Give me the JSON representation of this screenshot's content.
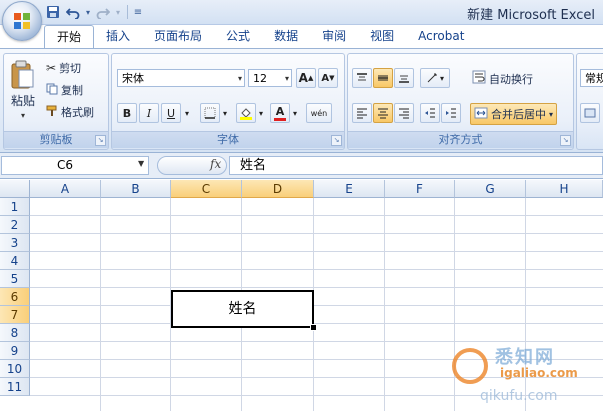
{
  "window": {
    "title": "新建 Microsoft Excel"
  },
  "quick_access": {
    "icons": [
      "save-icon",
      "undo-icon",
      "redo-icon",
      "customize-icon"
    ]
  },
  "tabs": [
    {
      "label": "开始",
      "active": true
    },
    {
      "label": "插入"
    },
    {
      "label": "页面布局"
    },
    {
      "label": "公式"
    },
    {
      "label": "数据"
    },
    {
      "label": "审阅"
    },
    {
      "label": "视图"
    },
    {
      "label": "Acrobat"
    }
  ],
  "ribbon": {
    "clipboard": {
      "paste": "粘贴",
      "cut": "剪切",
      "copy": "复制",
      "format_painter": "格式刷",
      "label": "剪贴板"
    },
    "font": {
      "font_name": "宋体",
      "font_size": "12",
      "grow": "A",
      "shrink": "A",
      "bold": "B",
      "italic": "I",
      "underline": "U",
      "font_color": "A",
      "phonetic": "wén",
      "label": "字体"
    },
    "alignment": {
      "wrap_text": "自动换行",
      "merge_center": "合并后居中",
      "label": "对齐方式"
    },
    "number": {
      "format": "常规"
    }
  },
  "formula_bar": {
    "name_box": "C6",
    "fx": "fx",
    "content": "姓名"
  },
  "sheet": {
    "columns": [
      "A",
      "B",
      "C",
      "D",
      "E",
      "F",
      "G",
      "H"
    ],
    "rows": [
      "1",
      "2",
      "3",
      "4",
      "5",
      "6",
      "7",
      "8",
      "9",
      "10",
      "11"
    ],
    "selected_columns": [
      "C",
      "D"
    ],
    "selected_rows": [
      "6",
      "7"
    ],
    "merged_cell": {
      "range": "C6:D7",
      "value": "姓名"
    }
  },
  "watermark": {
    "line1": "悉知网",
    "line2": "igaliao.com",
    "line3": "qikufu.com"
  },
  "colors": {
    "accent": "#15428b",
    "selection_header": "#f9cf7a",
    "ribbon_bg": "#dbe7f5"
  }
}
